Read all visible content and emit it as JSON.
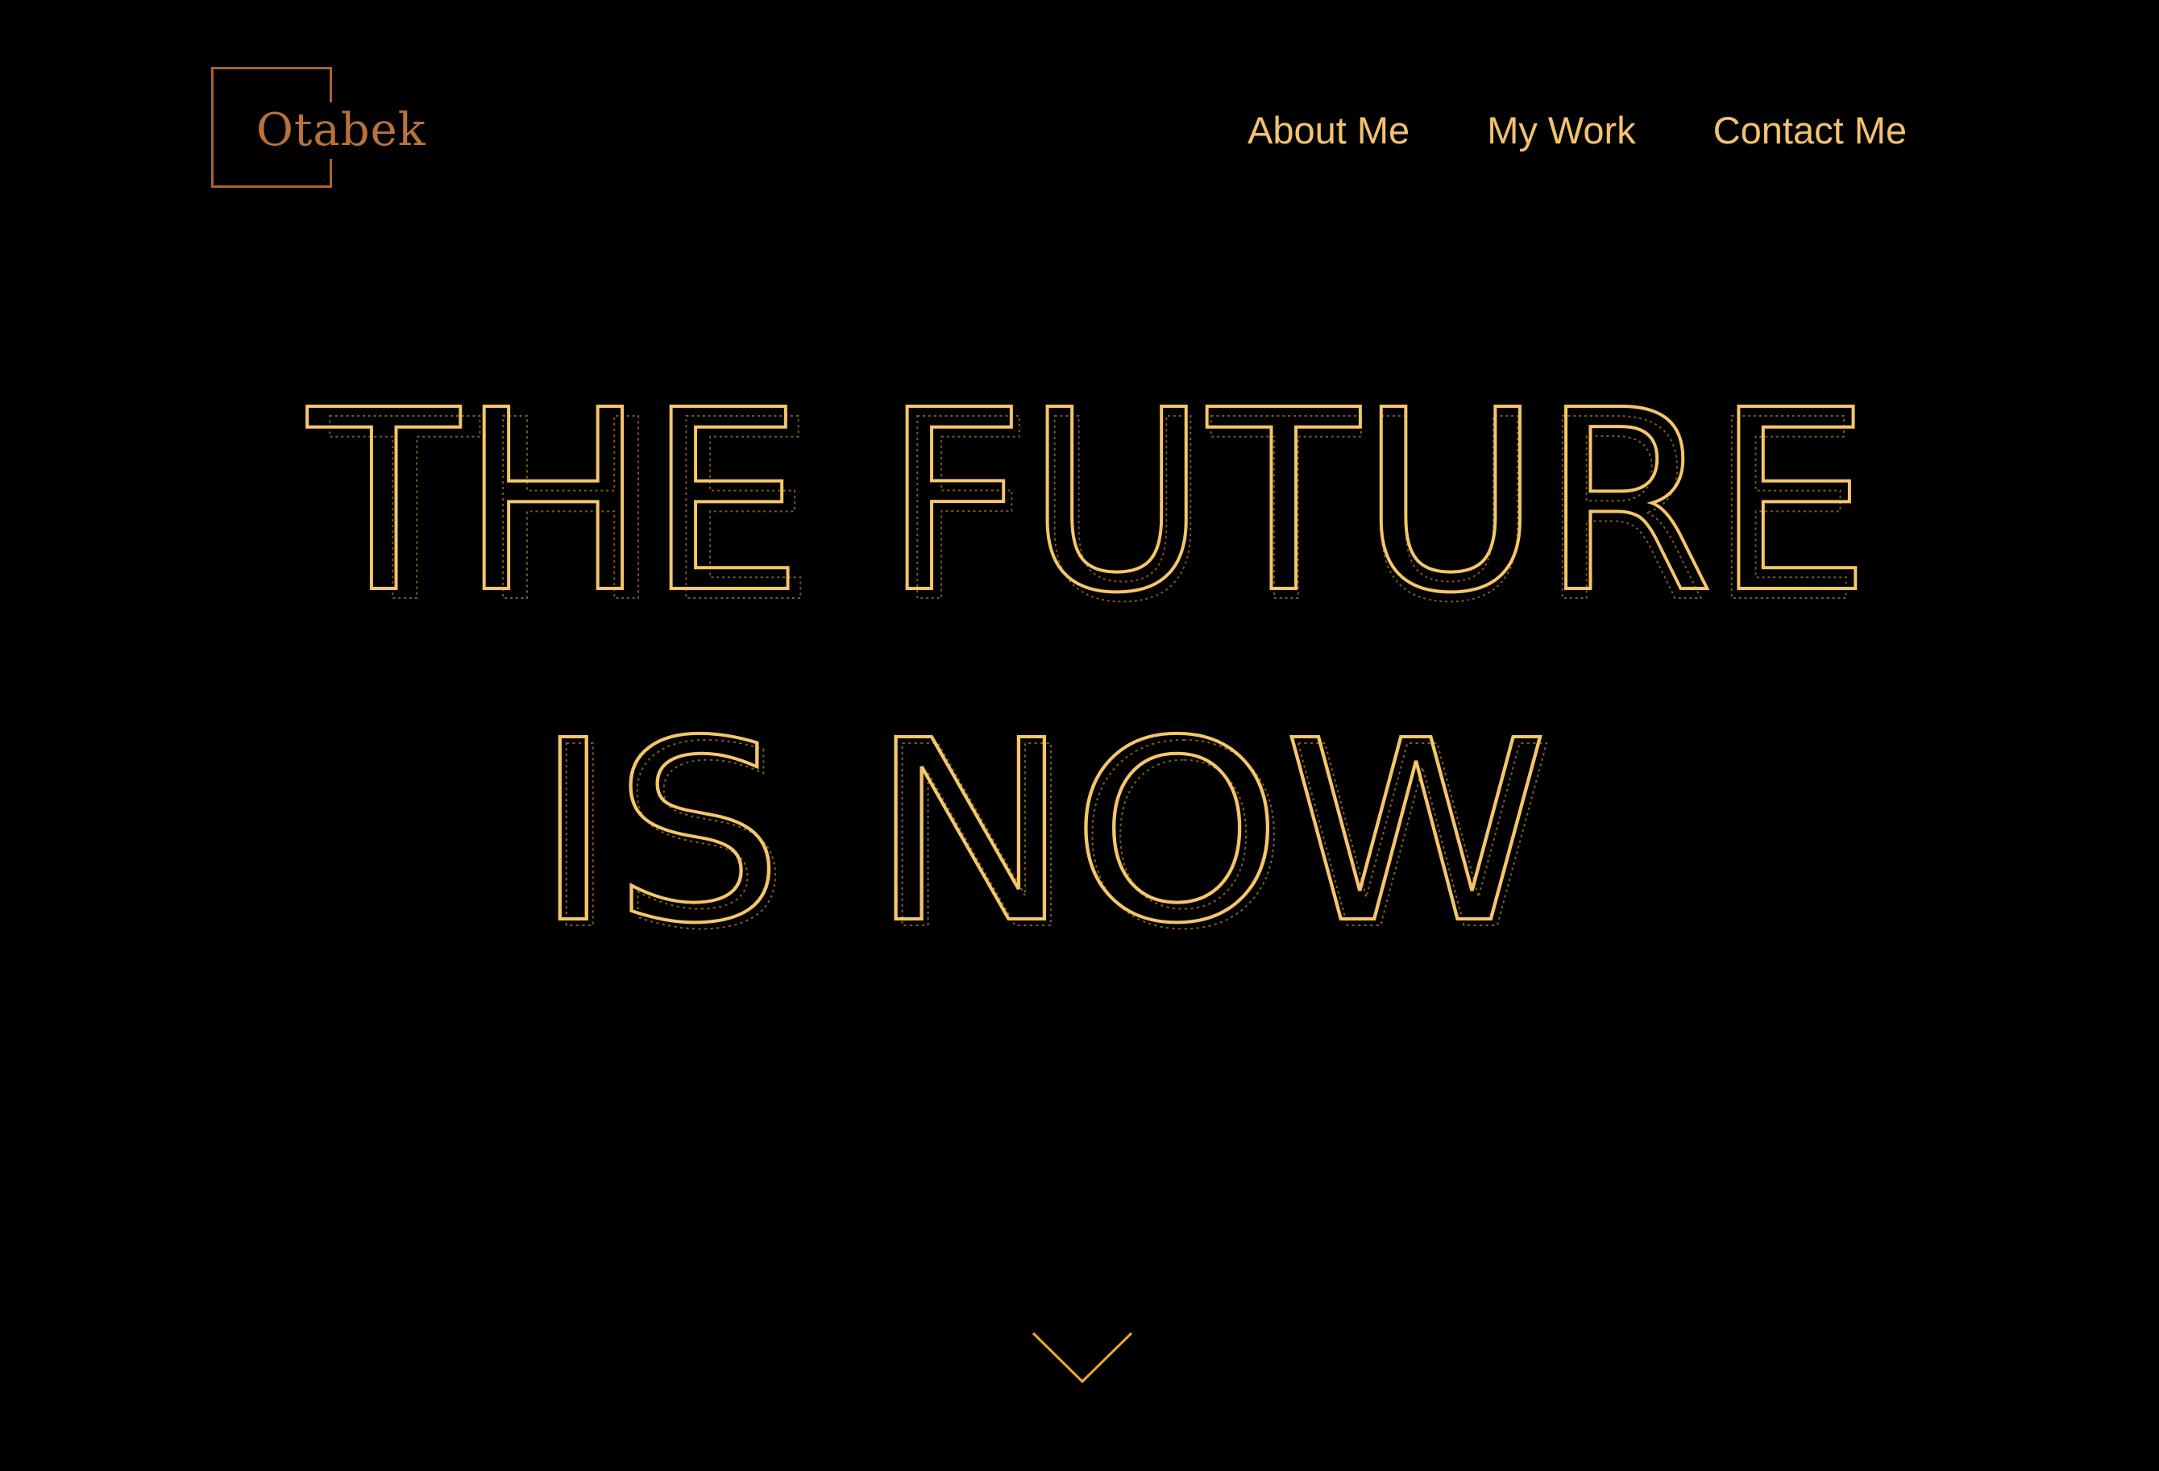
{
  "brand": {
    "logo_text": "Otabek"
  },
  "nav": {
    "items": [
      {
        "label": "About Me"
      },
      {
        "label": "My Work"
      },
      {
        "label": "Contact Me"
      }
    ]
  },
  "hero": {
    "line1": "THE FUTURE",
    "line2": "IS NOW"
  },
  "scroll": {
    "icon": "chevron-down-icon"
  },
  "colors": {
    "background": "#000000",
    "accent": "#f5c66a",
    "logo": "#b8723a"
  }
}
